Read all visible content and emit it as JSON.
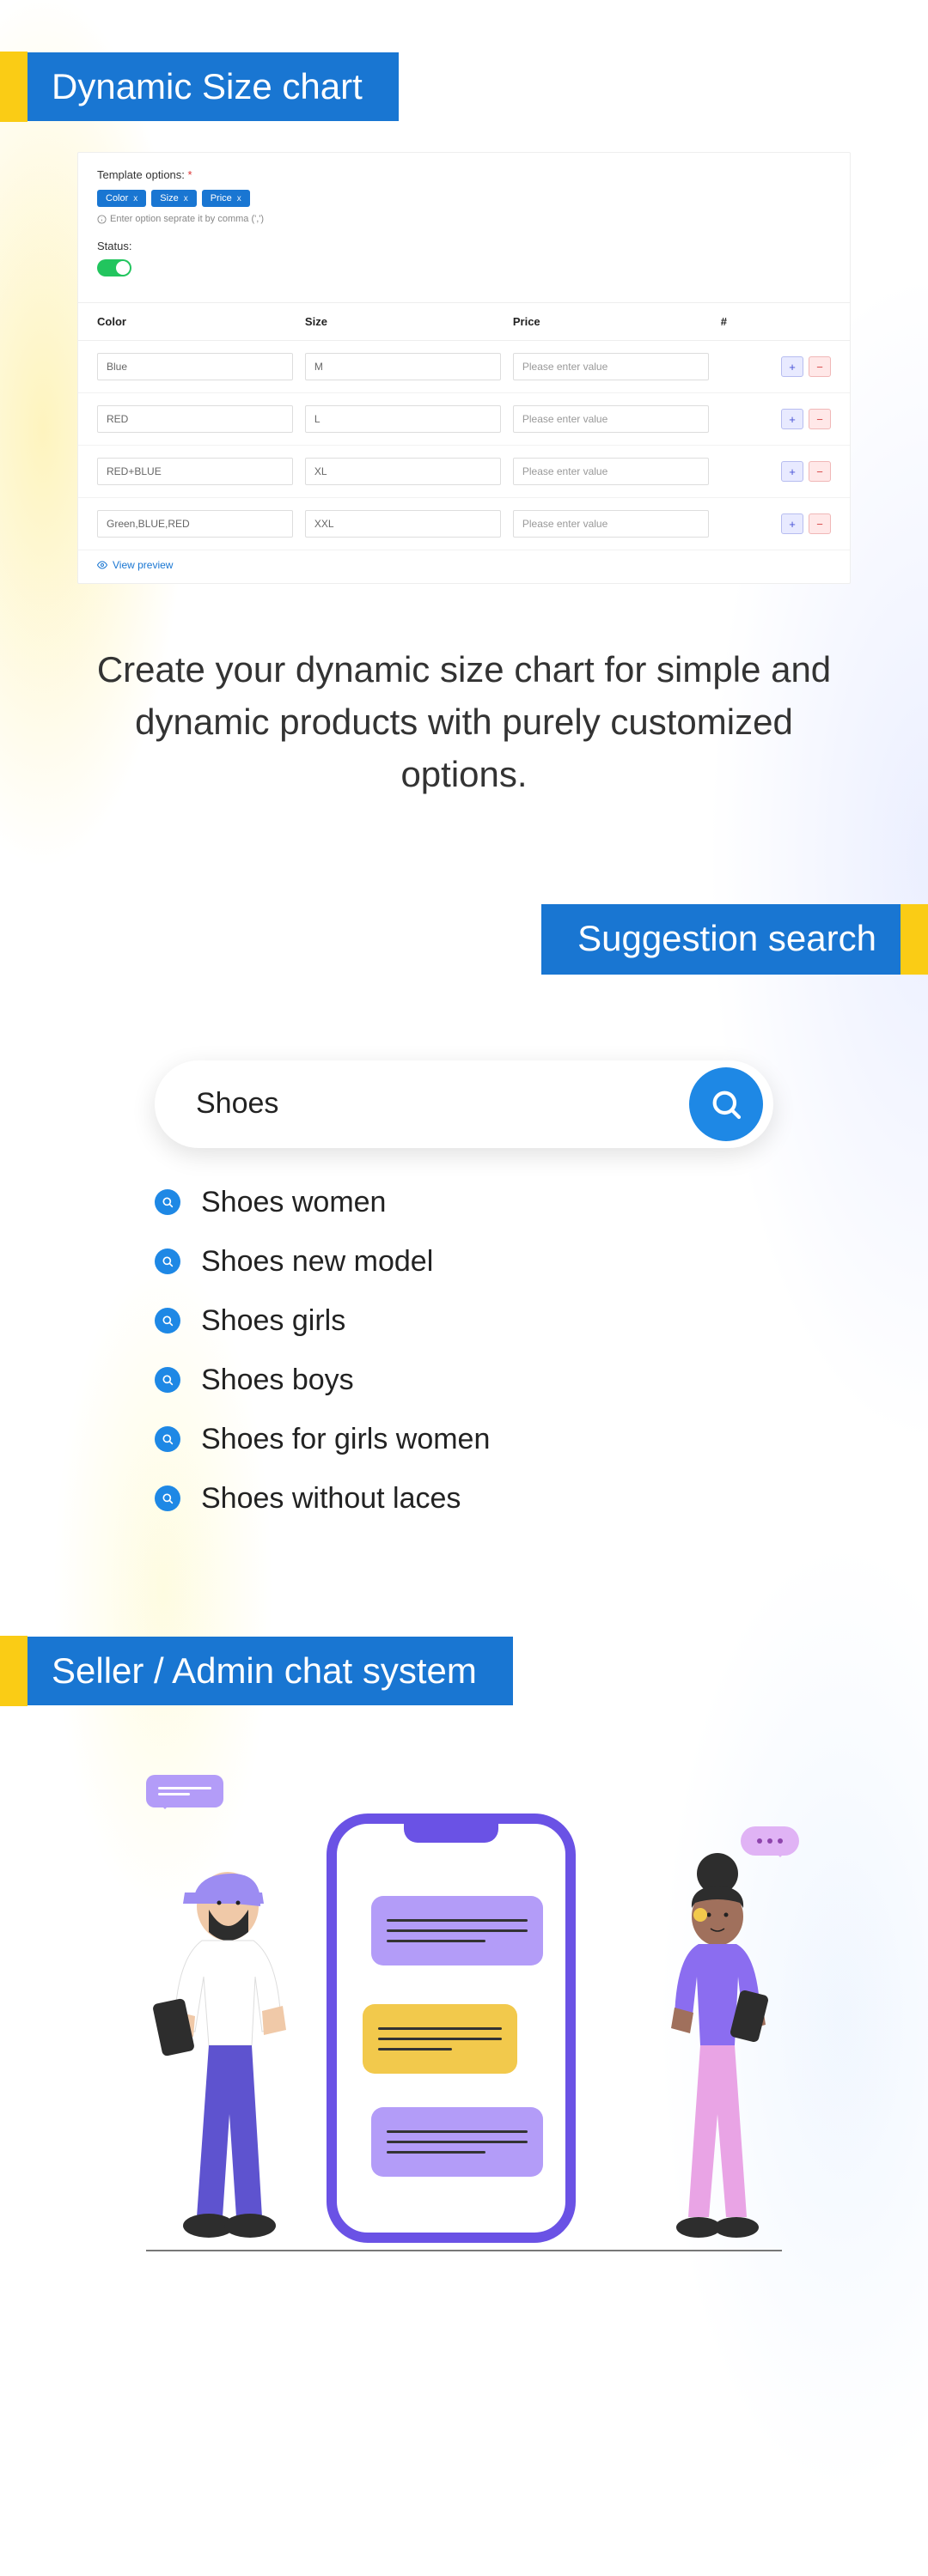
{
  "section1": {
    "title": "Dynamic Size chart",
    "template_options_label": "Template options:",
    "tags": [
      "Color",
      "Size",
      "Price"
    ],
    "hint": "Enter option seprate it by comma (',')",
    "status_label": "Status:",
    "columns": {
      "color": "Color",
      "size": "Size",
      "price": "Price",
      "action": "#"
    },
    "rows": [
      {
        "color": "Blue",
        "size": "M",
        "price_placeholder": "Please enter value"
      },
      {
        "color": "RED",
        "size": "L",
        "price_placeholder": "Please enter value"
      },
      {
        "color": "RED+BLUE",
        "size": "XL",
        "price_placeholder": "Please enter value"
      },
      {
        "color": "Green,BLUE,RED",
        "size": "XXL",
        "price_placeholder": "Please enter value"
      }
    ],
    "view_preview": "View preview",
    "description": "Create your dynamic size chart for simple and dynamic products with purely customized options."
  },
  "section2": {
    "title": "Suggestion search",
    "search_value": "Shoes",
    "suggestions": [
      "Shoes women",
      "Shoes new model",
      "Shoes girls",
      "Shoes boys",
      "Shoes for girls women",
      "Shoes without laces"
    ]
  },
  "section3": {
    "title": "Seller / Admin chat system"
  }
}
